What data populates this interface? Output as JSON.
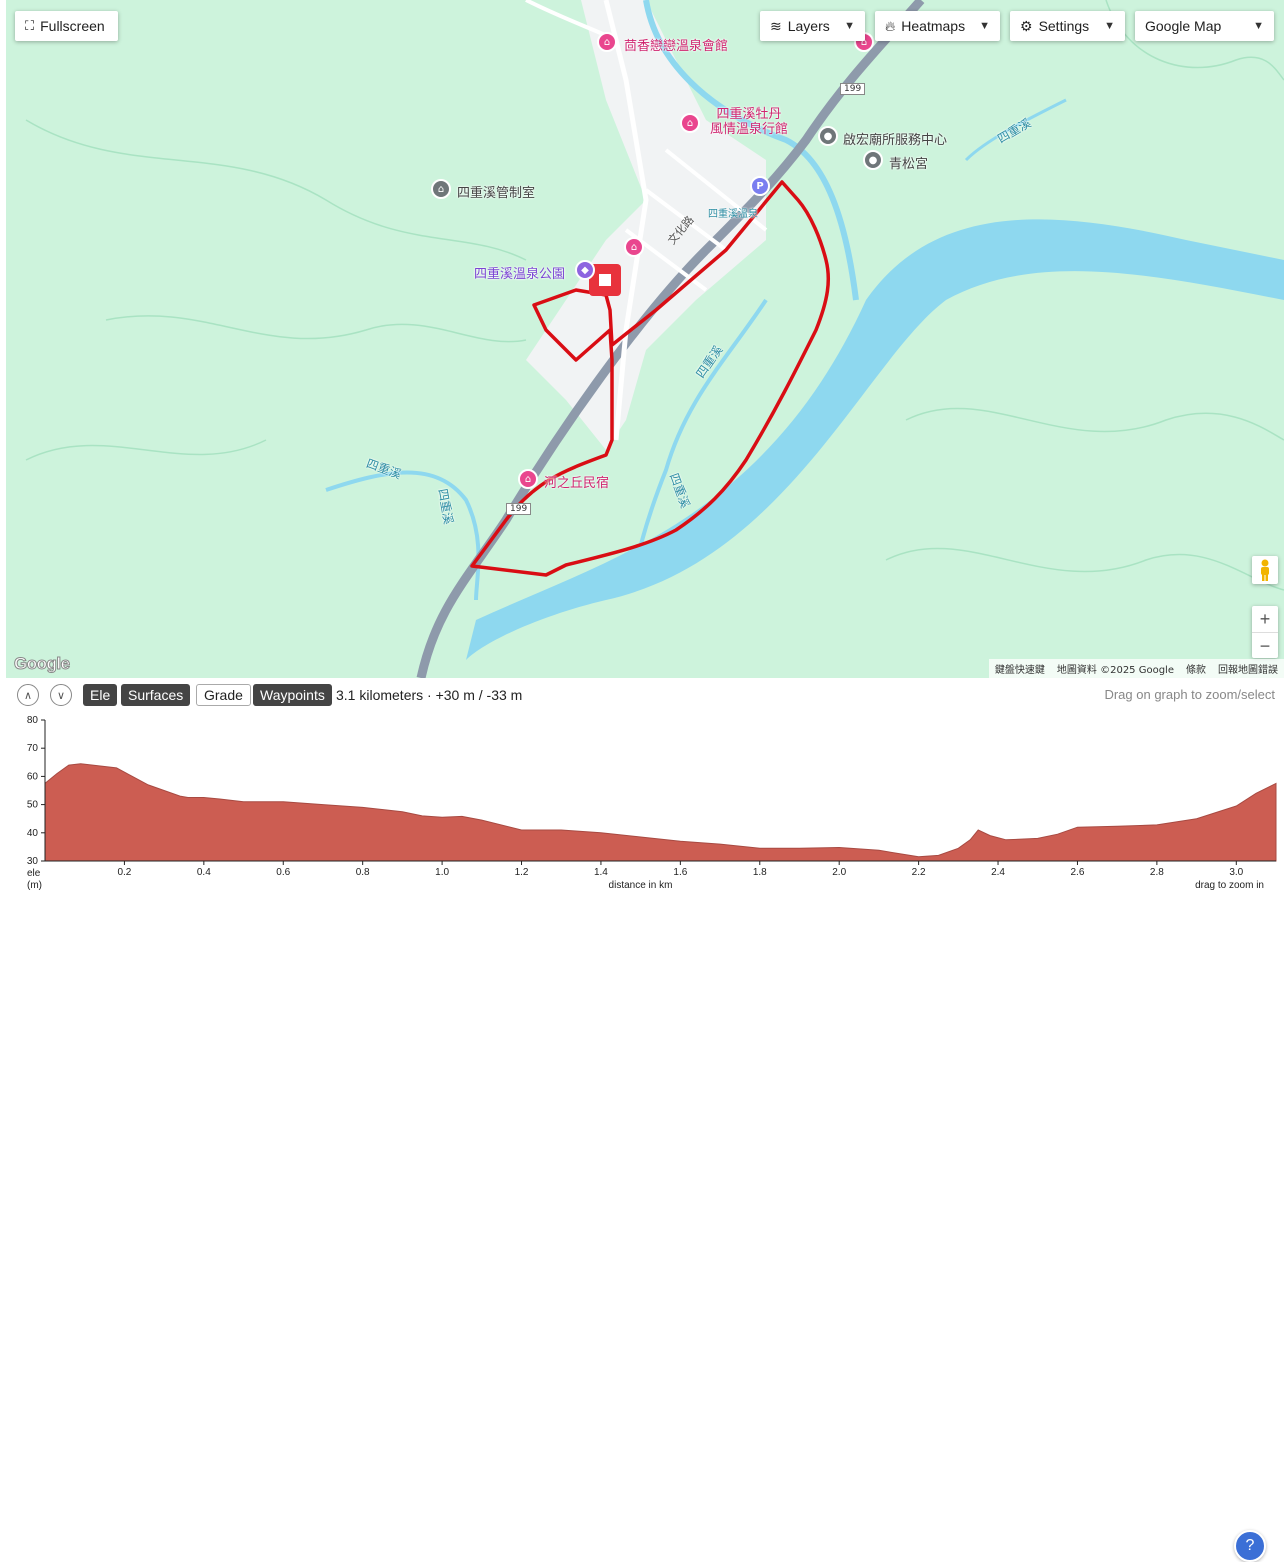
{
  "toolbar": {
    "fullscreen_label": "Fullscreen",
    "layers_label": "Layers",
    "heatmaps_label": "Heatmaps",
    "settings_label": "Settings",
    "map_type_selected": "Google Map"
  },
  "map": {
    "labels": {
      "hotel1": "茴香戀戀溫泉會館",
      "hotel2_line1": "四重溪牡丹",
      "hotel2_line2": "風情溫泉行館",
      "service": "啟宏廟所服務中心",
      "temple": "青松宮",
      "control_room": "四重溪管制室",
      "park": "四重溪溫泉公園",
      "bnb": "河之丘民宿",
      "road_wenhua": "文化路",
      "stream_top": "四重溪溫泉",
      "river_ne": "四重溪",
      "river_mid": "四重溪",
      "river_low": "四重溪",
      "river_w1": "四重溪",
      "river_w2": "四重溪",
      "route_shield": "199",
      "route_shield2": "199"
    },
    "attribution": {
      "shortcuts": "鍵盤快速鍵",
      "data": "地圖資料 ©2025 Google",
      "terms": "條款",
      "report": "回報地圖錯誤"
    },
    "zoom_in": "+",
    "zoom_out": "−",
    "google": "Google"
  },
  "elevation_panel": {
    "buttons": {
      "ele": "Ele",
      "surfaces": "Surfaces",
      "grade": "Grade",
      "waypoints": "Waypoints"
    },
    "summary": "3.1 kilometers · +30 m / -33 m",
    "hint": "Drag on graph to zoom/select",
    "drag_hint": "drag to zoom in",
    "help": "?"
  },
  "chart_data": {
    "type": "area",
    "xlabel": "distance in km",
    "ylabel": "ele (m)",
    "ylabel_line1": "ele",
    "ylabel_line2": "(m)",
    "xlim": [
      0,
      3.1
    ],
    "ylim": [
      30,
      80
    ],
    "xticks": [
      0.2,
      0.4,
      0.6,
      0.8,
      1.0,
      1.2,
      1.4,
      1.6,
      1.8,
      2.0,
      2.2,
      2.4,
      2.6,
      2.8,
      3.0
    ],
    "xtick_labels": [
      "0.2",
      "0.4",
      "0.6",
      "0.8",
      "1.0",
      "1.2",
      "1.4",
      "1.6",
      "1.8",
      "2.0",
      "2.2",
      "2.4",
      "2.6",
      "2.8",
      "3.0"
    ],
    "yticks": [
      30,
      40,
      50,
      60,
      70,
      80
    ],
    "ytick_labels": [
      "30",
      "40",
      "50",
      "60",
      "70",
      "80"
    ],
    "fill_color": "#cc5d52",
    "x": [
      0,
      0.03,
      0.06,
      0.09,
      0.12,
      0.18,
      0.22,
      0.26,
      0.3,
      0.34,
      0.36,
      0.4,
      0.44,
      0.5,
      0.6,
      0.7,
      0.8,
      0.9,
      0.95,
      1.0,
      1.05,
      1.1,
      1.2,
      1.3,
      1.4,
      1.5,
      1.6,
      1.7,
      1.8,
      1.9,
      2.0,
      2.1,
      2.2,
      2.25,
      2.3,
      2.33,
      2.35,
      2.38,
      2.42,
      2.5,
      2.55,
      2.6,
      2.7,
      2.8,
      2.9,
      3.0,
      3.05,
      3.1
    ],
    "y": [
      57.5,
      61,
      64,
      64.5,
      64,
      63,
      60,
      57,
      55,
      53,
      52.5,
      52.5,
      52,
      51,
      51,
      50,
      49,
      47.5,
      46,
      45.5,
      45.8,
      44.5,
      41,
      41,
      40,
      38.5,
      37,
      36,
      34.5,
      34.5,
      34.8,
      33.8,
      31.5,
      32,
      34.5,
      37.5,
      41,
      39,
      37.5,
      38,
      39.5,
      42,
      42.3,
      42.8,
      45,
      49.5,
      54,
      57.5
    ]
  }
}
